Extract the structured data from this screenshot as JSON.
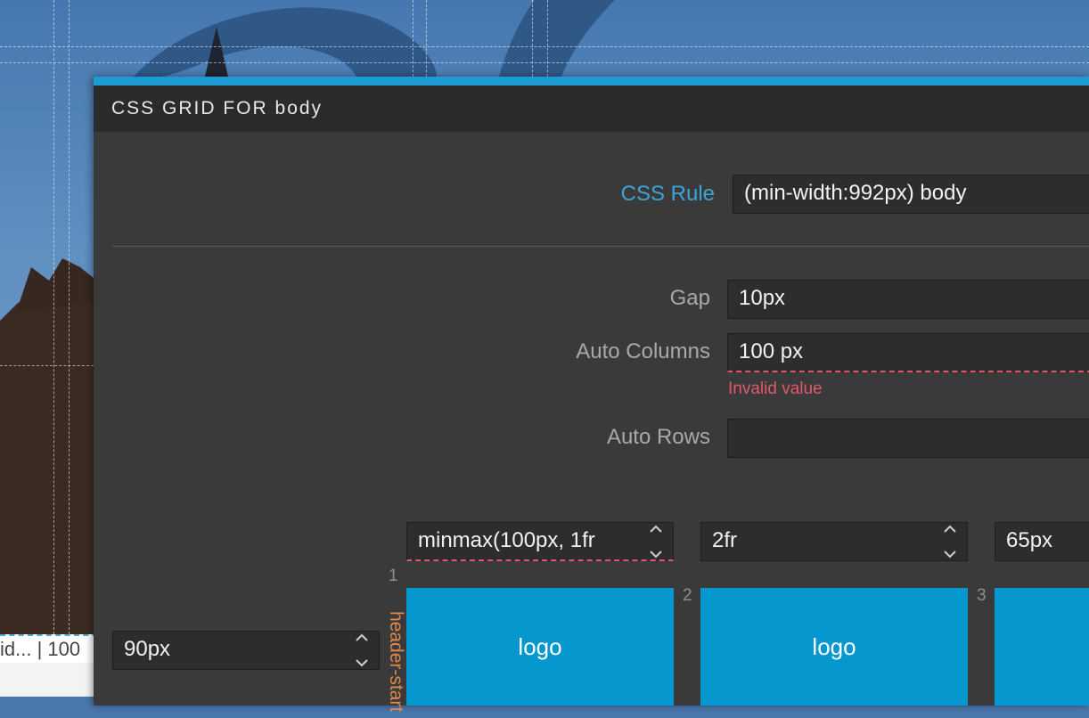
{
  "background": {
    "status_text": "id... | 100"
  },
  "dialog": {
    "title": "CSS GRID FOR body",
    "css_rule": {
      "label": "CSS Rule",
      "value": "(min-width:992px) body"
    },
    "gap": {
      "label": "Gap",
      "value": "10px"
    },
    "auto_columns": {
      "label": "Auto Columns",
      "value": "100 px",
      "error": "Invalid value"
    },
    "auto_rows": {
      "label": "Auto Rows",
      "value": ""
    },
    "columns": [
      {
        "value": "minmax(100px, 1fr",
        "invalid": true
      },
      {
        "value": "2fr",
        "invalid": false
      },
      {
        "value": "65px",
        "invalid": false
      }
    ],
    "rows": [
      {
        "value": "90px",
        "area_name": "header-start"
      }
    ],
    "track_numbers": [
      "1",
      "2",
      "3"
    ],
    "cells": [
      "logo",
      "logo",
      ""
    ]
  },
  "colors": {
    "accent": "#1e9bd2",
    "cell": "#0797cf",
    "error": "#e0596a",
    "area_name": "#e0884a"
  }
}
